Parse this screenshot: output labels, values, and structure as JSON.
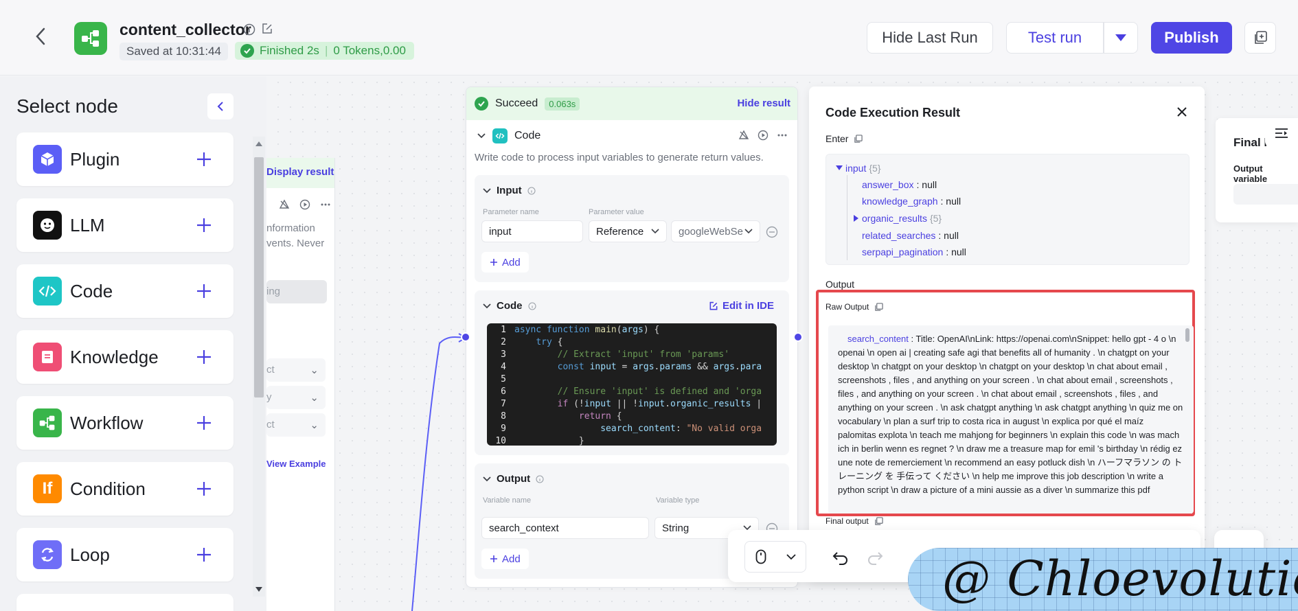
{
  "header": {
    "app_name": "content_collector",
    "saved": "Saved at 10:31:44",
    "status_finished": "Finished 2s",
    "status_tokens": "0 Tokens,0.00",
    "hide_last_run": "Hide Last Run",
    "test_run": "Test run",
    "publish": "Publish"
  },
  "node_panel": {
    "title": "Select node",
    "items": [
      {
        "label": "Plugin",
        "color": "#5b5ef6"
      },
      {
        "label": "LLM",
        "color": "#111111"
      },
      {
        "label": "Code",
        "color": "#1ec6c6"
      },
      {
        "label": "Knowledge",
        "color": "#ef4e75"
      },
      {
        "label": "Workflow",
        "color": "#39b54a"
      },
      {
        "label": "Condition",
        "color": "#ff8a00"
      },
      {
        "label": "Loop",
        "color": "#6f6ef7"
      }
    ]
  },
  "hidden_node": {
    "display_result": "Display result",
    "text1": "nformation",
    "text2": "vents. Never",
    "field1": "ing",
    "field2": "ct",
    "field3": "y",
    "field4": "ct",
    "view_example": "View Example"
  },
  "code_node": {
    "status": "Succeed",
    "time": "0.063s",
    "hide_result": "Hide result",
    "title": "Code",
    "description": "Write code to process input variables to generate return values.",
    "input_section": "Input",
    "param_name_label": "Parameter name",
    "param_value_label": "Parameter value",
    "param_name": "input",
    "param_type": "Reference",
    "param_ref": "googleWebSe",
    "add": "Add",
    "code_section": "Code",
    "edit_in_ide": "Edit in IDE",
    "code_lines": [
      "async function main(args) {",
      "    try {",
      "        // Extract 'input' from 'params'",
      "        const input = args.params && args.para",
      "",
      "        // Ensure 'input' is defined and 'orga",
      "        if (!input || !input.organic_results |",
      "            return {",
      "                search_content: \"No valid orga",
      "            }"
    ],
    "output_section": "Output",
    "var_name_label": "Variable name",
    "var_type_label": "Variable type",
    "var_name": "search_context",
    "var_type": "String"
  },
  "result_panel": {
    "title": "Code Execution Result",
    "enter": "Enter",
    "tree_root": "input",
    "tree_root_count": "{5}",
    "tree_items": [
      {
        "key": "answer_box",
        "value": " : null"
      },
      {
        "key": "knowledge_graph",
        "value": " : null"
      },
      {
        "key": "organic_results",
        "value": " {5}"
      },
      {
        "key": "related_searches",
        "value": " : null"
      },
      {
        "key": "serpapi_pagination",
        "value": " : null"
      }
    ],
    "output": "Output",
    "raw_output": "Raw Output",
    "raw_key": "search_content",
    "raw_text": " : Title: OpenAI\\nLink: https://openai.com\\nSnippet: hello gpt - 4 o \\n openai \\n open ai | creating safe agi that benefits all of humanity . \\n chatgpt on your desktop \\n chatgpt on your desktop \\n chatgpt on your desktop \\n chat about email , screenshots , files , and anything on your screen . \\n chat about email , screenshots , files , and anything on your screen . \\n chat about email , screenshots , files , and anything on your screen . \\n ask chatgpt anything \\n ask chatgpt anything \\n quiz me on vocabulary \\n plan a surf trip to costa rica in august \\n explica por qué el maíz palomitas explota \\n teach me mahjong for beginners \\n explain this code \\n was mach ich in berlin wenn es regnet ? \\n draw me a treasure map for emil 's birthday \\n rédig ez une note de remerciement \\n recommend an easy potluck dish \\n ハーフマラソン の トレーニング を 手伝って ください \\n help me improve this job description \\n write a python script \\n draw a picture of a mini aussie as a diver \\n summarize this pdf",
    "final_output": "Final output"
  },
  "final_card": {
    "title": "Final l",
    "output_var": "Output variable"
  },
  "watermark": "@ Chloevolution"
}
